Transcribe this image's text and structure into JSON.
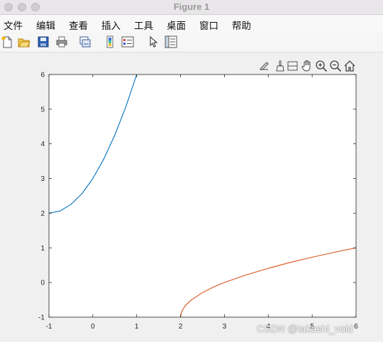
{
  "window": {
    "title": "Figure 1"
  },
  "menu": {
    "items": [
      "文件",
      "编辑",
      "查看",
      "插入",
      "工具",
      "桌面",
      "窗口",
      "帮助"
    ]
  },
  "toolbar": {
    "icons": [
      "new-figure-icon",
      "open-file-icon",
      "save-icon",
      "print-icon",
      "link-plot-icon",
      "insert-colorbar-icon",
      "insert-legend-icon",
      "edit-plot-arrow-icon",
      "property-inspector-icon"
    ]
  },
  "axes_toolbar": {
    "icons": [
      "export-icon",
      "brush-icon",
      "data-tips-icon",
      "pan-icon",
      "zoom-in-icon",
      "zoom-out-icon",
      "home-icon"
    ]
  },
  "chart_data": {
    "type": "line",
    "title": "",
    "xlabel": "",
    "ylabel": "",
    "xlim": [
      -1,
      6
    ],
    "ylim": [
      -1,
      6
    ],
    "xticks": [
      -1,
      0,
      1,
      2,
      3,
      4,
      5,
      6
    ],
    "yticks": [
      -1,
      0,
      1,
      2,
      3,
      4,
      5,
      6
    ],
    "grid": false,
    "legend": "none",
    "series": [
      {
        "color": "#0072bd",
        "x": [
          -1,
          -0.75,
          -0.5,
          -0.25,
          0,
          0.25,
          0.5,
          0.75,
          1
        ],
        "y": [
          2,
          2.06,
          2.25,
          2.56,
          3,
          3.56,
          4.25,
          5.06,
          6
        ]
      },
      {
        "color": "#d95319",
        "x": [
          2,
          2.02,
          2.06,
          2.12,
          2.25,
          2.5,
          2.75,
          3,
          3.5,
          4,
          4.5,
          5,
          5.5,
          6
        ],
        "y": [
          -1,
          -0.86,
          -0.76,
          -0.65,
          -0.5,
          -0.29,
          -0.13,
          0,
          0.22,
          0.41,
          0.58,
          0.73,
          0.87,
          1
        ]
      }
    ]
  },
  "watermark": {
    "text": "CSDN @takashi_void"
  }
}
